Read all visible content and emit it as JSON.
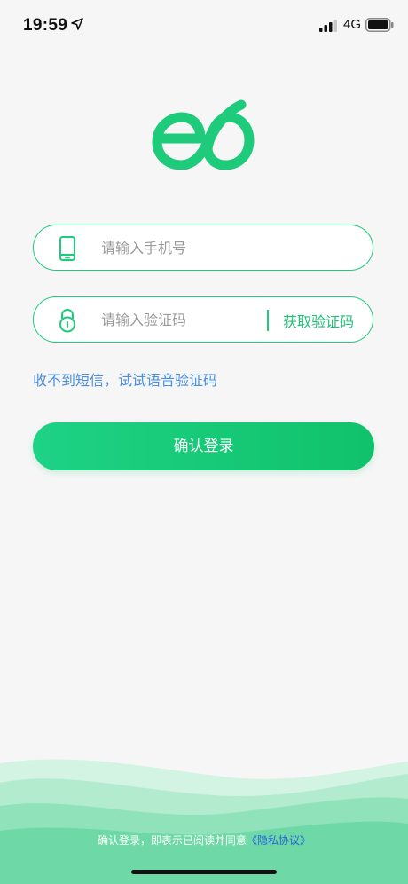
{
  "status_bar": {
    "time": "19:59",
    "network": "4G",
    "icons": [
      "location-arrow-icon",
      "signal-icon",
      "battery-icon"
    ]
  },
  "logo": {
    "icon": "eb-logo-icon",
    "color": "#1ecb7a"
  },
  "phone_field": {
    "placeholder": "请输入手机号",
    "value": "",
    "icon": "phone-icon"
  },
  "code_field": {
    "placeholder": "请输入验证码",
    "value": "",
    "icon": "lock-icon",
    "get_code_label": "获取验证码"
  },
  "voice_code_link": "收不到短信，试试语音验证码",
  "login_button": "确认登录",
  "agreement": {
    "prefix": "确认登录，即表示已阅读并同意",
    "link": "《隐私协议》"
  },
  "colors": {
    "accent": "#1ecb7a",
    "link_blue": "#4a8fe0",
    "privacy_link": "#2563d6",
    "background": "#f6f6f6"
  }
}
